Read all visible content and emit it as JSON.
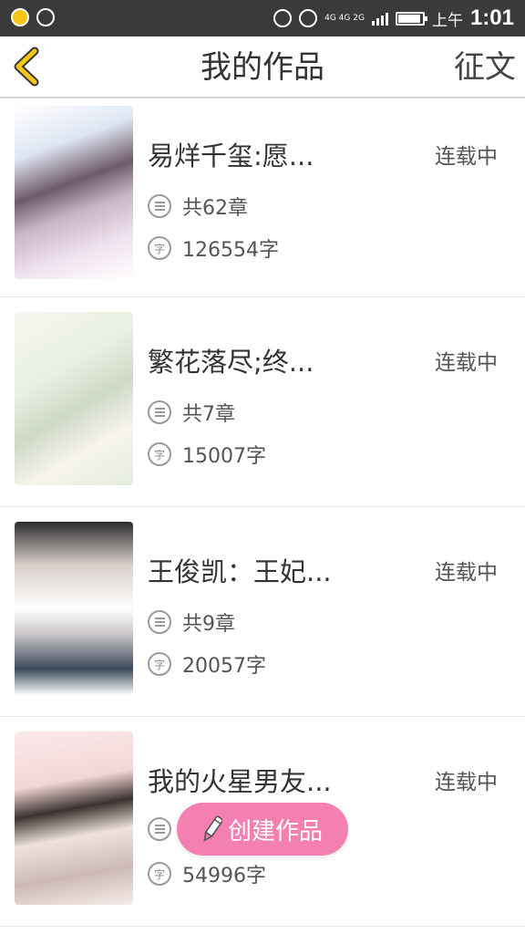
{
  "status_bar": {
    "network": "4G 4G 2G",
    "ampm": "上午",
    "time": "1:01"
  },
  "header": {
    "title": "我的作品",
    "action": "征文"
  },
  "works": [
    {
      "title": "易烊千玺:愿...",
      "status": "连载中",
      "chapters": "共62章",
      "words": "126554字",
      "word_icon": "字"
    },
    {
      "title": "繁花落尽;终...",
      "status": "连载中",
      "chapters": "共7章",
      "words": "15007字",
      "word_icon": "字"
    },
    {
      "title": "王俊凯：王妃...",
      "status": "连载中",
      "chapters": "共9章",
      "words": "20057字",
      "word_icon": "字"
    },
    {
      "title": "我的火星男友...",
      "status": "连载中",
      "chapters": "",
      "words": "54996字",
      "word_icon": "字"
    }
  ],
  "create_button": {
    "label": "创建作品"
  },
  "colors": {
    "status_bar": "#3a3a3a",
    "accent_yellow": "#f5c518",
    "create_button": "#f47fb1"
  }
}
